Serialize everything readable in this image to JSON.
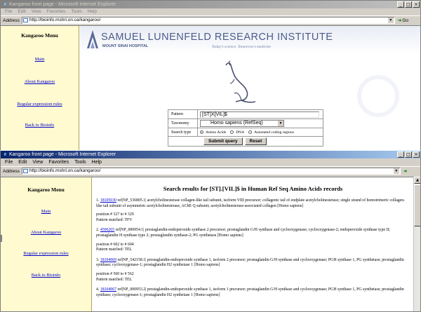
{
  "window1": {
    "title": "Kangaroo front page - Microsoft Internet Explorer",
    "menu": [
      "File",
      "Edit",
      "View",
      "Favorites",
      "Tools",
      "Help"
    ],
    "address_label": "Address",
    "url": "http://bioinfo.mshri.on.ca/kangaroo/",
    "go_label": "Go",
    "sidebar": {
      "title": "Kangaroo Menu",
      "links": [
        "Main",
        "About Kangaroo",
        "Regular expression rules",
        "Back to Bioinfo"
      ]
    },
    "banner": {
      "institute_name": "SAMUEL LUNENFELD RESEARCH INSTITUTE",
      "hospital": "MOUNT SINAI HOSPITAL",
      "tagline": "Today's science. Tomorrow's medicine"
    },
    "form": {
      "pattern_label": "Pattern",
      "pattern_value": "[ST]X[VIL]$",
      "taxonomy_label": "Taxonomy",
      "taxonomy_value": "Homo sapiens (RefSeq)",
      "search_type_label": "Search type",
      "search_types": [
        "Amino Acids",
        "DNA",
        "Annotated coding regions"
      ],
      "selected_search_type": "Amino Acids",
      "submit_label": "Submit query",
      "reset_label": "Reset"
    }
  },
  "window2": {
    "title": "Kangaroo front page - Microsoft Internet Explorer",
    "menu": [
      "File",
      "Edit",
      "View",
      "Favorites",
      "Tools",
      "Help"
    ],
    "address_label": "Address",
    "url": "http://bioinfo.mshri.on.ca/kangaroo/",
    "sidebar": {
      "title": "Kangaroo Menu",
      "links": [
        "Main",
        "About Kangaroo",
        "Regular expression rules",
        "Back to Bioinfo"
      ]
    },
    "results_title": "Search results for [ST].[VIL]$ in Human Ref Seq Amino Acids records",
    "results": [
      {
        "num": "1.",
        "id": "18105030",
        "desc": "ref|NP_536805.1| acetylcholinesterase collagen-like tail subunit, isoform VIII precursor; collagenic tail of endplate acetylcholinesterase; single strand of homotrimeric collagen-like tail subunit of asymmetric acetylcholinesterase, AChE Q subunit; acetylcholinesterase-associated collagen [Homo sapiens]",
        "position": "position # 327 to # 329",
        "matched": "Pattern matched: TFV"
      },
      {
        "num": "2.",
        "id": "4506265",
        "desc": "ref|NP_000954.1| prostaglandin-endoperoxide synthase 2 precursor; prostaglandin G/H synthase and cyclooxygenase; cyclooxygenase-2; endoperoxide synthase type II; prostaglandin H synthase type 2; prostaglandin synthase-2; PG synthetase [Homo sapiens]",
        "position": "position # 602 to # 604",
        "matched": "Pattern matched: TEL"
      },
      {
        "num": "3.",
        "id": "18104969",
        "desc": "ref|NP_542158.1| prostaglandin-endoperoxide synthase 1, isoform 2 precursor; prostaglandin G/H synthase and cyclooxygenase; PGH synthase 1, PG synthetase; prostaglandin synthase; cyclooxygenase-1; prostaglandin H2 synthetase 1 [Homo sapiens]",
        "position": "position # 560 to # 562",
        "matched": "Pattern matched: TEL"
      },
      {
        "num": "4.",
        "id": "18104967",
        "desc": "ref|NP_000953.2| prostaglandin-endoperoxide synthase 1, isoform 1 precursor; prostaglandin G/H synthase and cyclooxygenase; PGH synthase 1, PG synthetase; prostaglandin synthase; cyclooxygenase-1; prostaglandin H2 synthetase 1 [Homo sapiens]",
        "position": "",
        "matched": ""
      }
    ]
  }
}
